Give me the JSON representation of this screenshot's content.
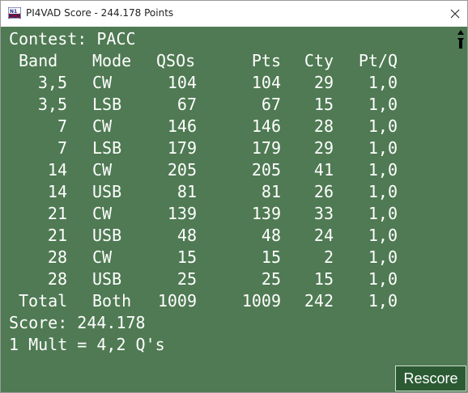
{
  "window": {
    "title": "PI4VAD Score - 244.178 Points",
    "icon": "n1mm-logo-icon",
    "close_icon": "close-icon"
  },
  "content": {
    "contest_line": "Contest: PACC",
    "headers": [
      "Band",
      "Mode",
      "QSOs",
      "Pts",
      "Cty",
      "Pt/Q"
    ],
    "rows": [
      [
        "3,5",
        "CW",
        "104",
        "104",
        "29",
        "1,0"
      ],
      [
        "3,5",
        "LSB",
        "67",
        "67",
        "15",
        "1,0"
      ],
      [
        "7",
        "CW",
        "146",
        "146",
        "28",
        "1,0"
      ],
      [
        "7",
        "LSB",
        "179",
        "179",
        "29",
        "1,0"
      ],
      [
        "14",
        "CW",
        "205",
        "205",
        "41",
        "1,0"
      ],
      [
        "14",
        "USB",
        "81",
        "81",
        "26",
        "1,0"
      ],
      [
        "21",
        "CW",
        "139",
        "139",
        "33",
        "1,0"
      ],
      [
        "21",
        "USB",
        "48",
        "48",
        "24",
        "1,0"
      ],
      [
        "28",
        "CW",
        "15",
        "15",
        "2",
        "1,0"
      ],
      [
        "28",
        "USB",
        "25",
        "25",
        "15",
        "1,0"
      ]
    ],
    "total": [
      "Total",
      "Both",
      "1009",
      "1009",
      "242",
      "1,0"
    ],
    "score_line": "Score: 244.178",
    "mult_line": "1 Mult = 4,2 Q's"
  },
  "buttons": {
    "rescore": "Rescore"
  },
  "colors": {
    "background": "#4f7a53",
    "button": "#2c5b33",
    "text": "#ffffff"
  }
}
